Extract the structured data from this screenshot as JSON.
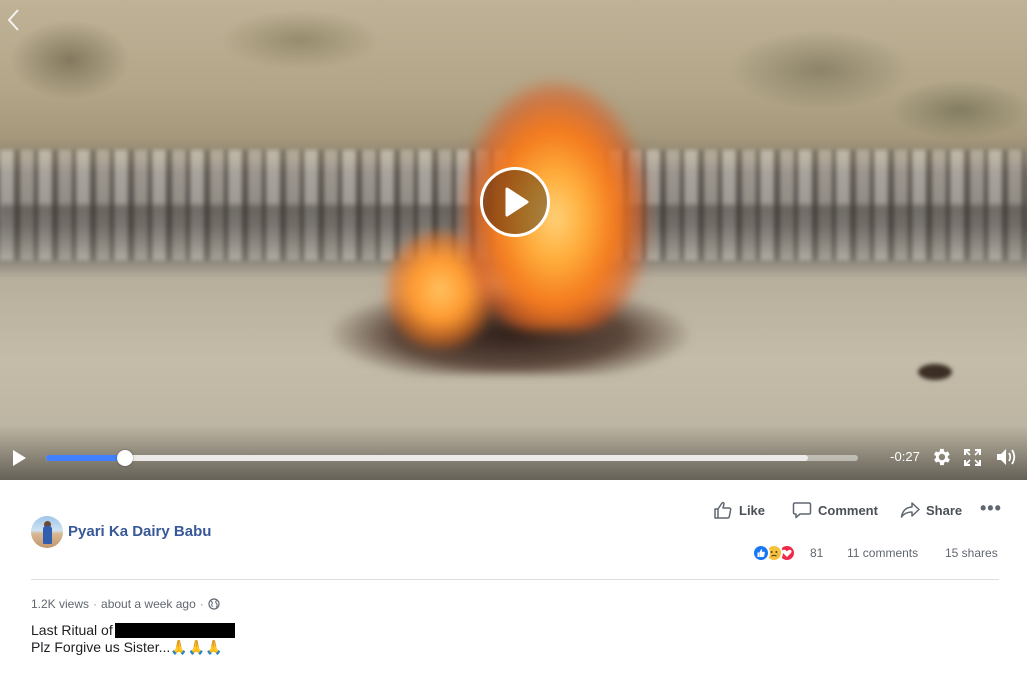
{
  "video": {
    "time_remaining": "-0:27",
    "progress_fraction": 0.097,
    "buffered_fraction": 0.938,
    "controls": {
      "play_icon": "play-icon",
      "settings_icon": "gear-icon",
      "fullscreen_icon": "fullscreen-icon",
      "volume_icon": "volume-icon",
      "back_icon": "chevron-left-icon"
    },
    "colors": {
      "progress": "#4080ff"
    }
  },
  "post": {
    "author": "Pyari Ka Dairy Babu",
    "actions": {
      "like_label": "Like",
      "comment_label": "Comment",
      "share_label": "Share",
      "more_label": "•••"
    },
    "reactions": {
      "types": [
        "like",
        "sad",
        "love"
      ],
      "count": "81"
    },
    "comments_count": "11 comments",
    "shares_count": "15 shares",
    "views": "1.2K views",
    "separator": "·",
    "time_ago": "about a week ago",
    "privacy_icon": "globe-icon",
    "caption_line1": "Last Ritual of",
    "caption_line2": "Plz Forgive us Sister...🙏🙏🙏"
  },
  "colors": {
    "author_link": "#385898",
    "like_reaction": "#1877f2",
    "sad_reaction": "#f7c23b",
    "love_reaction": "#f0284a"
  }
}
